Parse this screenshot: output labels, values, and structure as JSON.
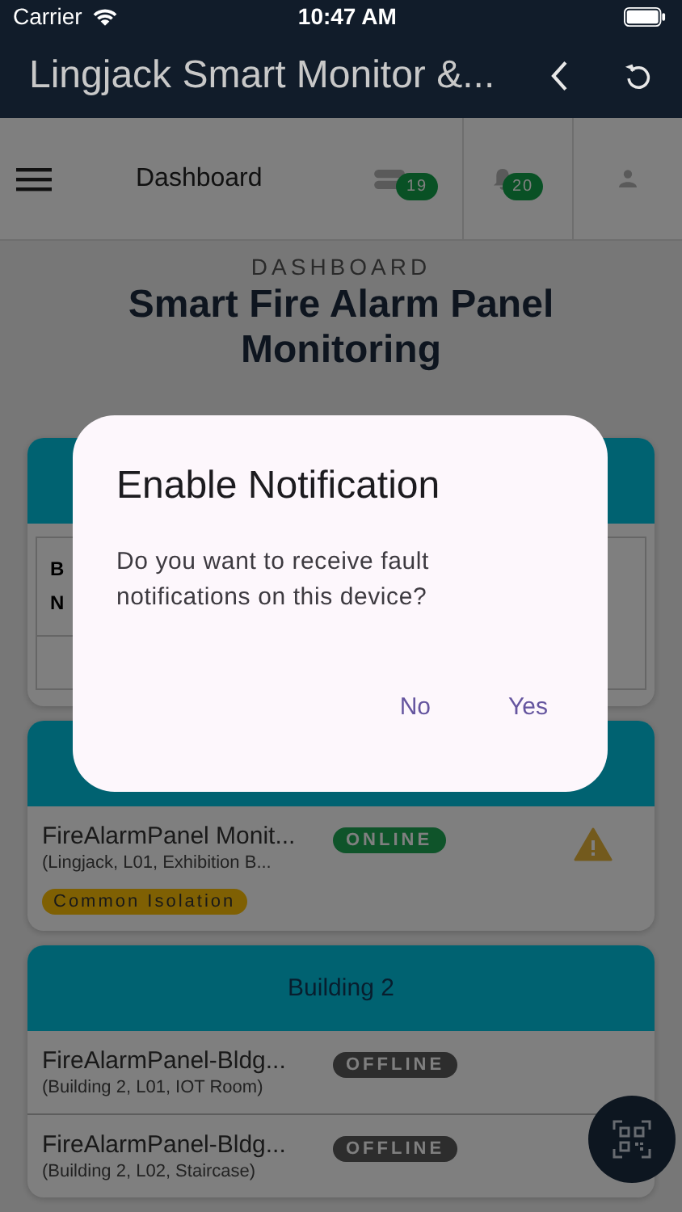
{
  "status_bar": {
    "carrier": "Carrier",
    "time": "10:47 AM"
  },
  "app_bar": {
    "title": "Lingjack Smart Monitor &..."
  },
  "toolbar": {
    "title": "Dashboard",
    "device_count": "19",
    "alert_count": "20"
  },
  "heading": {
    "overline": "DASHBOARD",
    "title": "Smart Fire Alarm Panel Monitoring"
  },
  "cards": [
    {
      "kind": "table",
      "table_header": [
        "B",
        "N"
      ]
    },
    {
      "kind": "panels",
      "rows": [
        {
          "name": "FireAlarmPanel Monit...",
          "location": "(Lingjack, L01, Exhibition B...",
          "online": true,
          "status_label": "ONLINE",
          "warning": true,
          "tag": "Common Isolation"
        }
      ]
    },
    {
      "kind": "panels",
      "header": "Building 2",
      "rows": [
        {
          "name": "FireAlarmPanel-Bldg...",
          "location": "(Building 2, L01, IOT Room)",
          "online": false,
          "status_label": "OFFLINE",
          "warning": false
        },
        {
          "name": "FireAlarmPanel-Bldg...",
          "location": "(Building 2, L02, Staircase)",
          "online": false,
          "status_label": "OFFLINE",
          "warning": false
        }
      ]
    }
  ],
  "dialog": {
    "title": "Enable Notification",
    "message": "Do you want to receive fault notifications on this device?",
    "buttons": [
      "No",
      "Yes"
    ]
  }
}
